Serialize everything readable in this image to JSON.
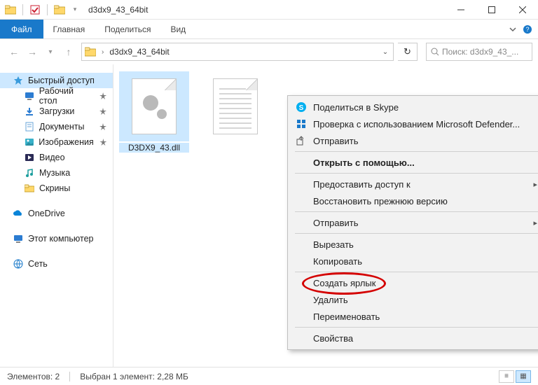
{
  "window": {
    "title": "d3dx9_43_64bit"
  },
  "ribbon": {
    "file": "Файл",
    "tabs": [
      "Главная",
      "Поделиться",
      "Вид"
    ]
  },
  "address": {
    "path": "d3dx9_43_64bit",
    "search_placeholder": "Поиск: d3dx9_43_..."
  },
  "sidebar": {
    "quick": "Быстрый доступ",
    "quick_items": [
      "Рабочий стол",
      "Загрузки",
      "Документы",
      "Изображения",
      "Видео",
      "Музыка",
      "Скрины"
    ],
    "onedrive": "OneDrive",
    "this_pc": "Этот компьютер",
    "network": "Сеть"
  },
  "files": [
    {
      "name": "D3DX9_43.dll",
      "selected": true,
      "kind": "dll"
    },
    {
      "name": "",
      "selected": false,
      "kind": "txt"
    }
  ],
  "context_menu": {
    "items": [
      {
        "label": "Поделиться в Skype",
        "icon": "skype"
      },
      {
        "label": "Проверка с использованием Microsoft Defender...",
        "icon": "defender"
      },
      {
        "label": "Отправить",
        "icon": "share",
        "sub": false
      },
      {
        "sep": true
      },
      {
        "label": "Открыть с помощью...",
        "bold": true
      },
      {
        "sep": true
      },
      {
        "label": "Предоставить доступ к",
        "sub": true
      },
      {
        "label": "Восстановить прежнюю версию"
      },
      {
        "sep": true
      },
      {
        "label": "Отправить",
        "sub": true
      },
      {
        "sep": true
      },
      {
        "label": "Вырезать"
      },
      {
        "label": "Копировать",
        "highlight": true
      },
      {
        "sep": true
      },
      {
        "label": "Создать ярлык"
      },
      {
        "label": "Удалить"
      },
      {
        "label": "Переименовать"
      },
      {
        "sep": true
      },
      {
        "label": "Свойства"
      }
    ]
  },
  "status": {
    "count": "Элементов: 2",
    "selection": "Выбран 1 элемент: 2,28 МБ"
  },
  "colors": {
    "accent": "#1979ca",
    "selection": "#cce8ff",
    "ring": "#d40000"
  }
}
